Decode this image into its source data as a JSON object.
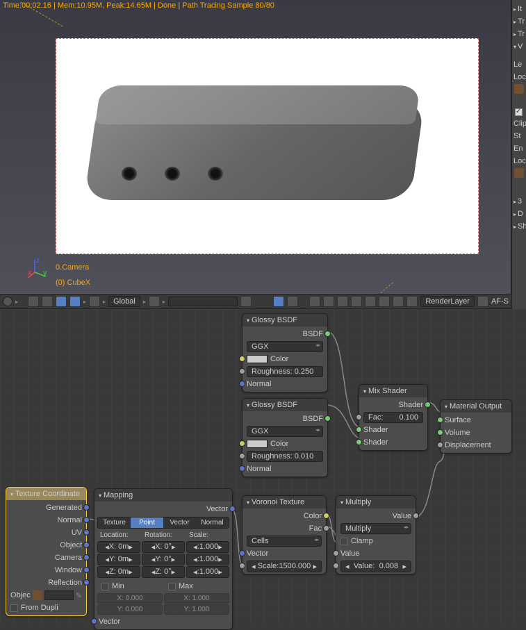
{
  "viewport": {
    "status": "Time:00:02.16 | Mem:10.95M, Peak:14.65M | Done | Path Tracing Sample 80/80",
    "camera": "0.Camera",
    "object": "(0) CubeX"
  },
  "toolbar": {
    "mode": "Global",
    "layer_label": "RenderLayer",
    "af": "AF-S"
  },
  "right": {
    "items": [
      "It",
      "Tr",
      "Tr",
      "V"
    ],
    "lock": "Le",
    "loc1": "Loc",
    "clip": "Clip",
    "st": "St",
    "en": "En",
    "loc2": "Loc",
    "more": [
      "3",
      "D",
      "Sh"
    ]
  },
  "nodes": {
    "tc": {
      "title": "Texture Coordinate",
      "outputs": [
        "Generated",
        "Normal",
        "UV",
        "Object",
        "Camera",
        "Window",
        "Reflection"
      ],
      "obj_label": "Objec",
      "dupli": "From Dupli"
    },
    "map": {
      "title": "Mapping",
      "out": "Vector",
      "tabs": [
        "Texture",
        "Point",
        "Vector",
        "Normal"
      ],
      "cols": [
        "Location:",
        "Rotation:",
        "Scale:"
      ],
      "loc": [
        "X: 0m",
        "Y: 0m",
        "Z: 0m"
      ],
      "rot": [
        "X: 0°",
        "Y: 0°",
        "Z: 0°"
      ],
      "scl": [
        ":1.000",
        ":1.000",
        ":1.000"
      ],
      "min": "Min",
      "max": "Max",
      "min_vals": [
        "X:    0.000",
        "Y:    0.000"
      ],
      "max_vals": [
        "X:    1.000",
        "Y:    1.000"
      ],
      "in": "Vector"
    },
    "g1": {
      "title": "Glossy BSDF",
      "out": "BSDF",
      "dist": "GGX",
      "color": "Color",
      "rough": "Roughness: 0.250",
      "normal": "Normal"
    },
    "g2": {
      "title": "Glossy BSDF",
      "out": "BSDF",
      "dist": "GGX",
      "color": "Color",
      "rough": "Roughness: 0.010",
      "normal": "Normal"
    },
    "mix": {
      "title": "Mix Shader",
      "out": "Shader",
      "fac": "Fac:",
      "fac_val": "0.100",
      "s1": "Shader",
      "s2": "Shader"
    },
    "mat": {
      "title": "Material Output",
      "surf": "Surface",
      "vol": "Volume",
      "disp": "Displacement"
    },
    "vor": {
      "title": "Voronoi Texture",
      "color": "Color",
      "fac": "Fac",
      "coloring": "Cells",
      "vec": "Vector",
      "scale": "Scale:1500.000"
    },
    "mul": {
      "title": "Multiply",
      "out": "Value",
      "op": "Multiply",
      "clamp": "Clamp",
      "v1": "Value",
      "v2": "Value:",
      "v2_val": "0.008"
    }
  }
}
